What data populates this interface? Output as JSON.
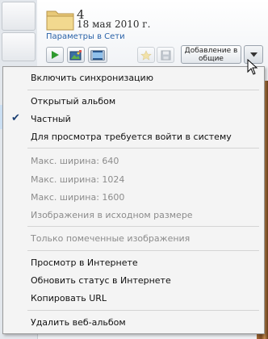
{
  "header": {
    "album_number": "4",
    "album_date": "18 мая 2010 г.",
    "settings_link": "Параметры в Сети",
    "share_button_line1": "Добавление в",
    "share_button_line2": "общие"
  },
  "toolbar_icons": [
    "play-icon",
    "image-edit-icon",
    "slideshow-icon",
    "star-icon",
    "save-icon"
  ],
  "menu": {
    "sync": "Включить синхронизацию",
    "public_album": "Открытый альбом",
    "private": "Частный",
    "login_required": "Для просмотра требуется войти в систему",
    "max_640": "Макс. ширина: 640",
    "max_1024": "Макс. ширина: 1024",
    "max_1600": "Макс. ширина: 1600",
    "original_size": "Изображения в исходном размере",
    "flagged_only": "Только помеченные изображения",
    "view_online": "Просмотр в Интернете",
    "refresh_status": "Обновить статус в Интернете",
    "copy_url": "Копировать URL",
    "delete_album": "Удалить веб-альбом",
    "checked_item": "Частный"
  },
  "colors": {
    "link": "#2a62a8",
    "disabled_text": "#8c8c8c",
    "check": "#1b3f73",
    "menu_background": "#f4f4f4"
  }
}
